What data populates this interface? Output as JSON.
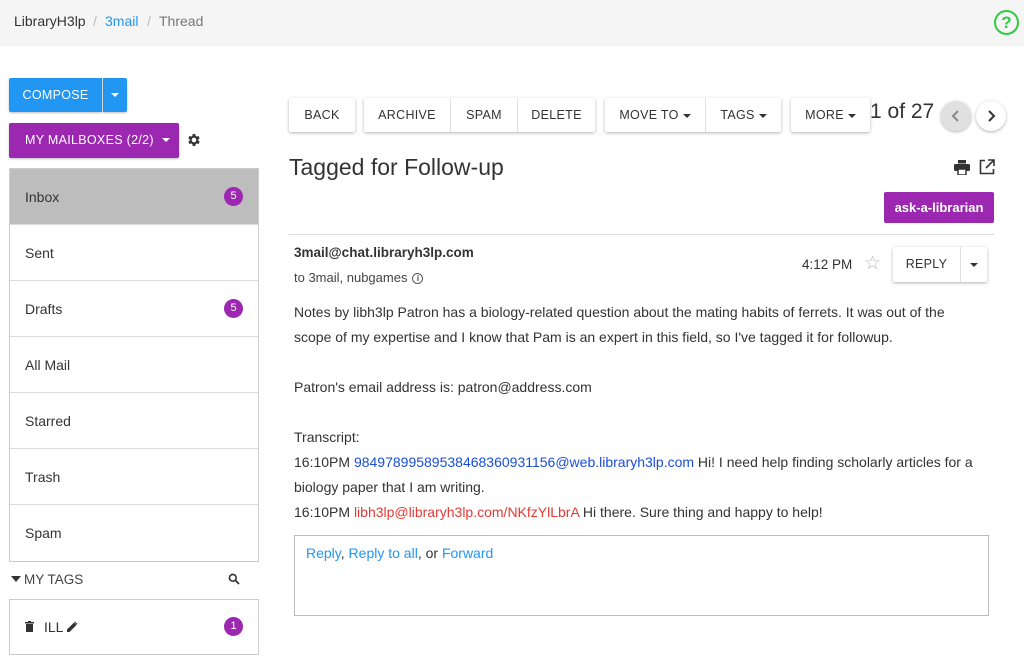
{
  "breadcrumb": {
    "root": "LibraryH3lp",
    "section": "3mail",
    "current": "Thread",
    "separator": "/"
  },
  "help_icon": "?",
  "sidebar": {
    "compose_label": "COMPOSE",
    "mailboxes_label": "MY MAILBOXES (2/2)",
    "mailboxes": [
      {
        "label": "Inbox",
        "count": "5"
      },
      {
        "label": "Sent",
        "count": ""
      },
      {
        "label": "Drafts",
        "count": "5"
      },
      {
        "label": "All Mail",
        "count": ""
      },
      {
        "label": "Starred",
        "count": ""
      },
      {
        "label": "Trash",
        "count": ""
      },
      {
        "label": "Spam",
        "count": ""
      }
    ],
    "tags_header": "MY TAGS",
    "tags": [
      {
        "label": "ILL",
        "count": "1"
      }
    ]
  },
  "toolbar": {
    "back": "BACK",
    "archive": "ARCHIVE",
    "spam": "SPAM",
    "delete": "DELETE",
    "move_to": "MOVE TO",
    "tags": "TAGS",
    "more": "MORE",
    "pager": "1 of 27"
  },
  "thread": {
    "title": "Tagged for Follow-up",
    "tag": "ask-a-librarian"
  },
  "message": {
    "from": "3mail@chat.libraryh3lp.com",
    "to": "to 3mail, nubgames",
    "time": "4:12 PM",
    "reply_label": "REPLY",
    "note_line1": "Notes by libh3lp Patron has a biology-related question about the mating habits of ferrets. It was out of the",
    "note_line2": "scope of my expertise and I know that Pam is an expert in this field, so I've tagged it for followup.",
    "email_line": "Patron's email address is: patron@address.com",
    "transcript_label": "Transcript:",
    "t1_time": "16:10PM",
    "t1_user": "98497899589538468360931156@web.libraryh3lp.com",
    "t1_text_a": " Hi! I need help finding scholarly articles for a",
    "t1_text_b": "biology paper that I am writing.",
    "t2_time": "16:10PM",
    "t2_user": "libh3lp@libraryh3lp.com/NKfzYlLbrA",
    "t2_text": " Hi there. Sure thing and happy to help!"
  },
  "reply_box": {
    "reply": "Reply",
    "sep1": ", ",
    "reply_all": "Reply to all",
    "sep2": ", or ",
    "forward": "Forward"
  },
  "colors": {
    "primary": "#2196f3",
    "accent": "#9c27b0",
    "help": "#2ecc40"
  }
}
